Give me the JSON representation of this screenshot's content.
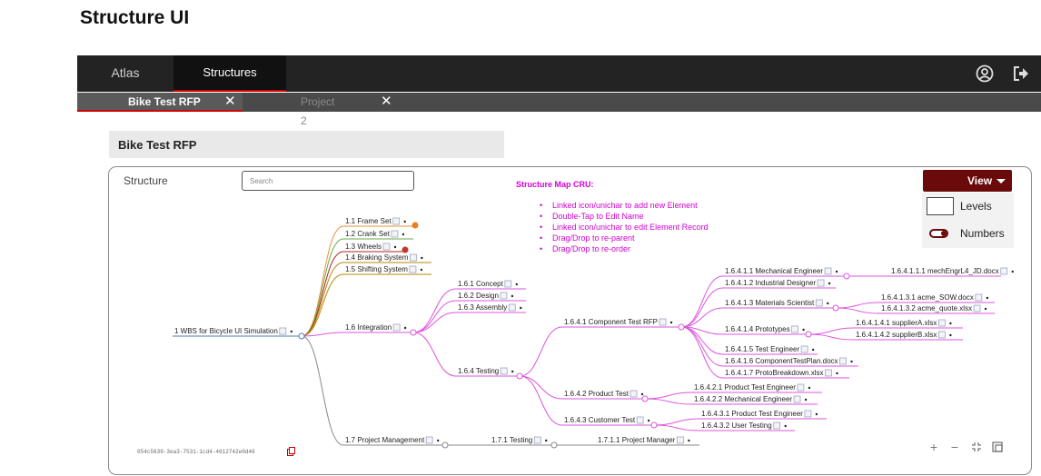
{
  "page": {
    "title": "Structure UI"
  },
  "topbar": {
    "nav": [
      {
        "label": "Atlas"
      },
      {
        "label": "Structures"
      }
    ],
    "icons": [
      "user-circle-icon",
      "logout-icon"
    ]
  },
  "tabs": [
    {
      "label": "Bike Test RFP",
      "active": true
    },
    {
      "label": "Project 2",
      "active": false
    }
  ],
  "project": {
    "title": "Bike Test RFP"
  },
  "panel": {
    "title": "Structure",
    "search_placeholder": "Search",
    "notes_title": "Structure Map CRU:",
    "notes": [
      "Linked icon/unichar to add new Element",
      "Double-Tap to Edit Name",
      "Linked icon/unichar to edit Element Record",
      "Drag/Drop to re-parent",
      "Drag/Drop to re-order"
    ],
    "view_button": "View",
    "view_menu": {
      "levels_label": "Levels",
      "numbers_label": "Numbers",
      "numbers_on": true
    },
    "hash": "054c5639-3ea3-7531-1cd4-4612742e0d46",
    "zoom_controls": [
      "plus-icon",
      "minus-icon",
      "fit-icon",
      "expand-icon"
    ]
  },
  "colors": {
    "accent": "#6b0a0a",
    "branch": "#dd55dd",
    "tab_underline": "#cc0000"
  },
  "tree": {
    "root": "1 WBS for Bicycle UI Simulation",
    "nodes": {
      "n11": "1.1 Frame Set",
      "n12": "1.2 Crank Set",
      "n13": "1.3 Wheels",
      "n14": "1.4 Braking System",
      "n15": "1.5 Shifting System",
      "n16": "1.6 Integration",
      "n17": "1.7 Project Management",
      "n161": "1.6.1 Concept",
      "n162": "1.6.2 Design",
      "n163": "1.6.3 Assembly",
      "n164": "1.6.4 Testing",
      "n1641": "1.6.4.1 Component Test RFP",
      "n1642": "1.6.4.2 Product Test",
      "n1643": "1.6.4.3 Customer Test",
      "n16411": "1.6.4.1.1 Mechanical Engineer",
      "n16412": "1.6.4.1.2 Industrial Designer",
      "n16413": "1.6.4.1.3 Materials Scientist",
      "n16414": "1.6.4.1.4 Prototypes",
      "n16415": "1.6.4.1.5 Test Engineer",
      "n16416": "1.6.4.1.6 ComponentTestPlan.docx",
      "n16417": "1.6.4.1.7 ProtoBreakdown.xlsx",
      "n164111": "1.6.4.1.1.1 mechEngrL4_JD.docx",
      "n164131": "1.6.4.1.3.1 acme_SOW.docx",
      "n164132": "1.6.4.1.3.2 acme_quote.xlsx",
      "n164141": "1.6.4.1.4.1 supplierA.xlsx",
      "n164142": "1.6.4.1.4.2 supplierB.xlsx",
      "n16421": "1.6.4.2.1 Product Test Engineer",
      "n16422": "1.6.4.2.2 Mechanical Engineer",
      "n16431": "1.6.4.3.1 Product Test Engineer",
      "n16432": "1.6.4.3.2 User Testing",
      "n171": "1.7.1 Testing",
      "n1711": "1.7.1.1 Project Manager"
    }
  }
}
